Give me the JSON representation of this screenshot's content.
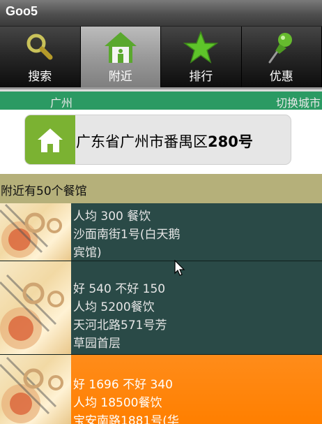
{
  "app": {
    "title": "Goo5"
  },
  "tabs": [
    {
      "label": "搜索",
      "icon": "search-icon"
    },
    {
      "label": "附近",
      "icon": "home-icon"
    },
    {
      "label": "排行",
      "icon": "star-icon"
    },
    {
      "label": "优惠",
      "icon": "pushpin-icon"
    }
  ],
  "city": {
    "name": "广州",
    "switch_label": "切换城市"
  },
  "address": {
    "text": "广东省广州市番禺区",
    "number": "280号"
  },
  "nearby": {
    "text": "附近有50个餐馆"
  },
  "restaurants": [
    {
      "lines": [
        "人均  300  餐饮",
        "沙面南街1号(白天鹅",
        "宾馆)"
      ]
    },
    {
      "lines": [
        "好   540  不好  150",
        "人均 5200餐饮",
        "天河北路571号芳",
        "草园首层"
      ]
    },
    {
      "lines": [
        "好   1696  不好  340",
        "人均 18500餐饮",
        "宝安南路1881号(华"
      ]
    }
  ],
  "colors": {
    "accent_green": "#2b9a63",
    "row_dark": "#2a4a47",
    "row_highlight": "#ff8c1a",
    "nearby_bar": "#b5b07a"
  }
}
